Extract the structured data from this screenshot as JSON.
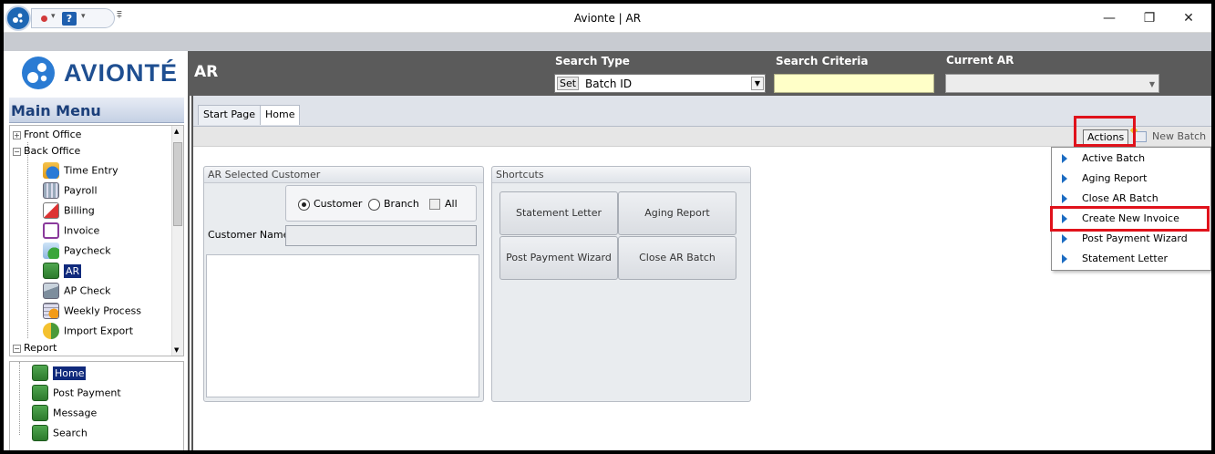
{
  "window": {
    "title": "Avionte | AR",
    "minimize": "—",
    "maximize": "❐",
    "close": "✕"
  },
  "qat": {
    "help_label": "?",
    "dropdown_glyph": "▾",
    "customize_glyph": "⩱"
  },
  "header": {
    "logo_text": "AVIONTÉ",
    "module_title": "AR",
    "search_type_label": "Search Type",
    "search_type_set": "Set",
    "search_type_value": "Batch ID",
    "search_criteria_label": "Search Criteria",
    "search_criteria_value": "",
    "current_ar_label": "Current AR",
    "current_ar_value": ""
  },
  "sidebar": {
    "title": "Main Menu",
    "groups": [
      {
        "label": "Front Office",
        "toggle": "+"
      },
      {
        "label": "Back Office",
        "toggle": "−"
      },
      {
        "label": "Report",
        "toggle": "−"
      }
    ],
    "back_office_items": [
      {
        "label": "Time Entry",
        "icon": "time-entry-icon"
      },
      {
        "label": "Payroll",
        "icon": "payroll-icon"
      },
      {
        "label": "Billing",
        "icon": "billing-icon"
      },
      {
        "label": "Invoice",
        "icon": "invoice-icon"
      },
      {
        "label": "Paycheck",
        "icon": "paycheck-icon"
      },
      {
        "label": "AR",
        "icon": "ar-icon",
        "selected": true
      },
      {
        "label": "AP Check",
        "icon": "ap-check-icon"
      },
      {
        "label": "Weekly Process",
        "icon": "weekly-process-icon"
      },
      {
        "label": "Import Export",
        "icon": "import-export-icon"
      }
    ],
    "sub_items": [
      {
        "label": "Home",
        "icon": "ledger-icon",
        "selected": true
      },
      {
        "label": "Post Payment",
        "icon": "ledger-icon"
      },
      {
        "label": "Message",
        "icon": "ledger-icon"
      },
      {
        "label": "Search",
        "icon": "ledger-icon"
      }
    ]
  },
  "tabs": [
    {
      "label": "Start Page",
      "active": false
    },
    {
      "label": "Home",
      "active": true
    }
  ],
  "toolbar": {
    "actions_label": "Actions",
    "new_batch_label": "New Batch"
  },
  "actions_menu": [
    {
      "label": "Active Batch"
    },
    {
      "label": "Aging Report"
    },
    {
      "label": "Close AR Batch"
    },
    {
      "label": "Create New Invoice",
      "highlighted": true
    },
    {
      "label": "Post Payment Wizard"
    },
    {
      "label": "Statement Letter"
    }
  ],
  "ar_panel": {
    "title": "AR Selected Customer",
    "radio_customer": "Customer",
    "radio_branch": "Branch",
    "checkbox_all": "All",
    "customer_name_label": "Customer Name",
    "customer_name_value": ""
  },
  "shortcuts": {
    "title": "Shortcuts",
    "buttons": [
      {
        "label": "Statement Letter"
      },
      {
        "label": "Aging Report"
      },
      {
        "label": "Post Payment Wizard"
      },
      {
        "label": "Close AR Batch"
      }
    ]
  },
  "colors": {
    "highlight_red": "#e0121b",
    "selection_navy": "#102a7c",
    "header_gray": "#5b5b5b",
    "logo_blue": "#1f4f91",
    "criteria_yellow": "#ffffc8"
  }
}
